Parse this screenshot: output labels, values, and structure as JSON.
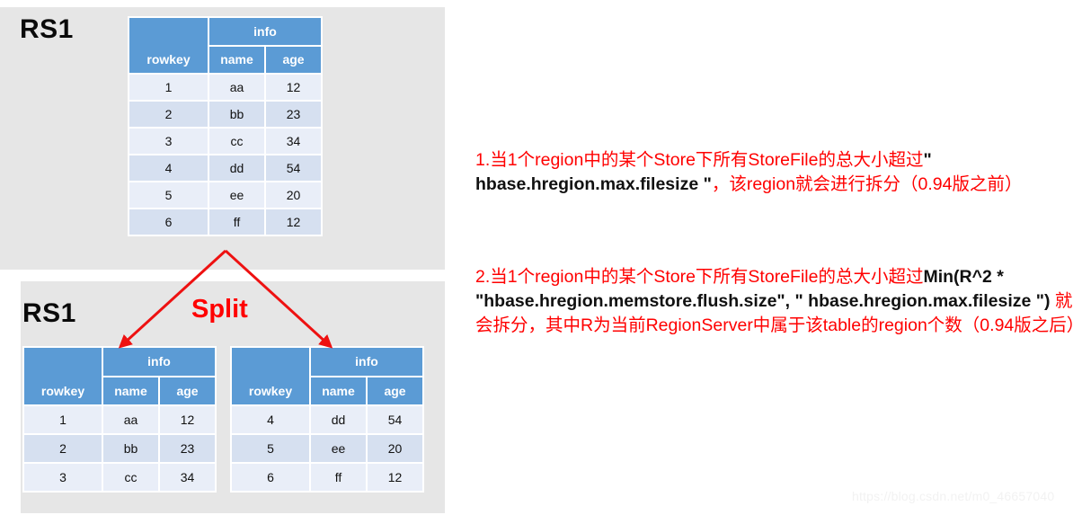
{
  "panels": {
    "top": {
      "label": "RS1"
    },
    "bottom": {
      "label": "RS1"
    }
  },
  "split_label": "Split",
  "table_top": {
    "headers": {
      "rowkey": "rowkey",
      "info": "info",
      "name": "name",
      "age": "age"
    },
    "rows": [
      {
        "rowkey": "1",
        "name": "aa",
        "age": "12"
      },
      {
        "rowkey": "2",
        "name": "bb",
        "age": "23"
      },
      {
        "rowkey": "3",
        "name": "cc",
        "age": "34"
      },
      {
        "rowkey": "4",
        "name": "dd",
        "age": "54"
      },
      {
        "rowkey": "5",
        "name": "ee",
        "age": "20"
      },
      {
        "rowkey": "6",
        "name": "ff",
        "age": "12"
      }
    ]
  },
  "table_left": {
    "headers": {
      "rowkey": "rowkey",
      "info": "info",
      "name": "name",
      "age": "age"
    },
    "rows": [
      {
        "rowkey": "1",
        "name": "aa",
        "age": "12"
      },
      {
        "rowkey": "2",
        "name": "bb",
        "age": "23"
      },
      {
        "rowkey": "3",
        "name": "cc",
        "age": "34"
      }
    ]
  },
  "table_right": {
    "headers": {
      "rowkey": "rowkey",
      "info": "info",
      "name": "name",
      "age": "age"
    },
    "rows": [
      {
        "rowkey": "4",
        "name": "dd",
        "age": "54"
      },
      {
        "rowkey": "5",
        "name": "ee",
        "age": "20"
      },
      {
        "rowkey": "6",
        "name": "ff",
        "age": "12"
      }
    ]
  },
  "notes": [
    {
      "parts": [
        {
          "text": "1.当1个region中的某个Store下所有StoreFile的总大小超过",
          "bold": false
        },
        {
          "text": "\" hbase.hregion.max.filesize \"",
          "bold": true
        },
        {
          "text": "，该region就会进行拆分（0.94版之前）",
          "bold": false
        }
      ]
    },
    {
      "parts": [
        {
          "text": "2.当1个region中的某个Store下所有StoreFile的总大小超过",
          "bold": false
        },
        {
          "text": "Min(R^2 * \"hbase.hregion.memstore.flush.size\", \" hbase.hregion.max.filesize \")",
          "bold": true
        },
        {
          "text": " 就会拆分，其中R为当前RegionServer中属于该table的region个数（0.94版之后）",
          "bold": false
        }
      ]
    }
  ],
  "watermark": "https://blog.csdn.net/m0_46657040",
  "colors": {
    "panel_bg": "#e6e6e6",
    "header_blue": "#5b9bd5",
    "row_light": "#e9eef8",
    "row_dark": "#d6e0f0",
    "accent_red": "#ff0000",
    "label_black": "#0a0a0a"
  }
}
